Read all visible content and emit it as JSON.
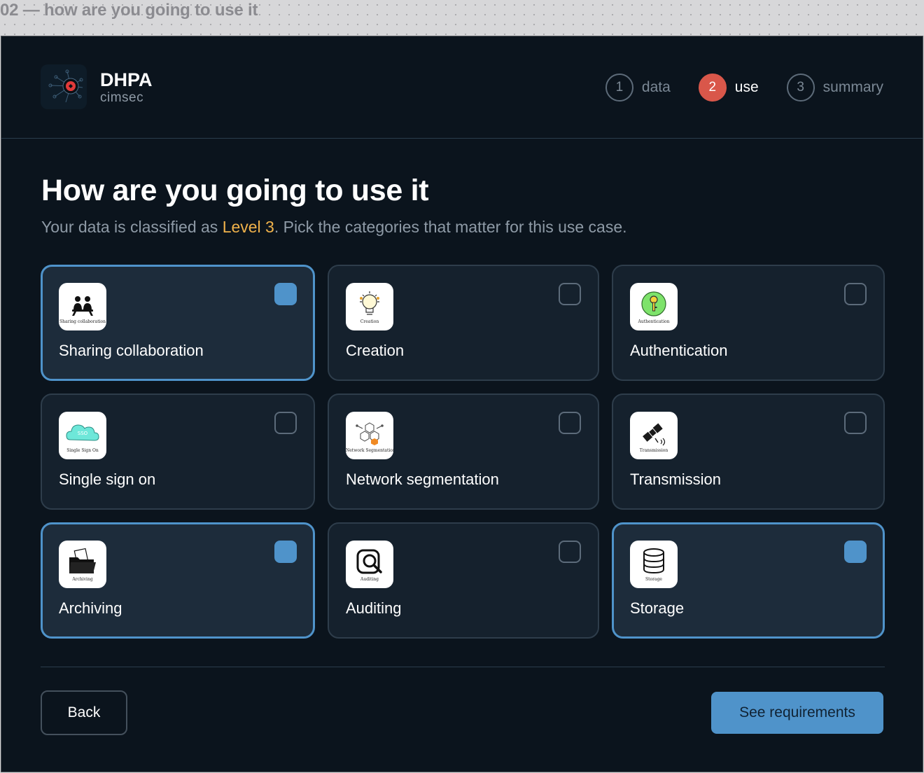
{
  "frame": {
    "label": "02 — how are you going to use it"
  },
  "brand": {
    "name": "DHPA",
    "sub": "cimsec"
  },
  "steps": [
    {
      "num": "1",
      "label": "data",
      "active": false
    },
    {
      "num": "2",
      "label": "use",
      "active": true
    },
    {
      "num": "3",
      "label": "summary",
      "active": false
    }
  ],
  "page": {
    "title": "How are you going to use it",
    "subtitle_before": "Your data is classified as ",
    "subtitle_level": "Level 3",
    "subtitle_after": ". Pick the categories that matter for this use case."
  },
  "cards": [
    {
      "label": "Sharing collaboration",
      "icon": "sharing-collaboration-icon",
      "icon_caption": "Sharing collaboration",
      "selected": true
    },
    {
      "label": "Creation",
      "icon": "lightbulb-icon",
      "icon_caption": "Creation",
      "selected": false
    },
    {
      "label": "Authentication",
      "icon": "key-icon",
      "icon_caption": "Authentication",
      "selected": false
    },
    {
      "label": "Single sign on",
      "icon": "cloud-sso-icon",
      "icon_caption": "Single Sign On",
      "icon_badge": "SSO",
      "selected": false
    },
    {
      "label": "Network segmentation",
      "icon": "network-hexagons-icon",
      "icon_caption": "Network Segmentation",
      "selected": false
    },
    {
      "label": "Transmission",
      "icon": "satellite-icon",
      "icon_caption": "Transmission",
      "selected": false
    },
    {
      "label": "Archiving",
      "icon": "folder-archive-icon",
      "icon_caption": "Archiving",
      "selected": true
    },
    {
      "label": "Auditing",
      "icon": "magnifier-audit-icon",
      "icon_caption": "Auditing",
      "selected": false
    },
    {
      "label": "Storage",
      "icon": "database-icon",
      "icon_caption": "Storage",
      "selected": true
    }
  ],
  "actions": {
    "back": "Back",
    "next": "See requirements"
  },
  "colors": {
    "accent": "#4f93ca",
    "active_step": "#d9574a",
    "level": "#f0b24b",
    "background": "#0b141d"
  }
}
